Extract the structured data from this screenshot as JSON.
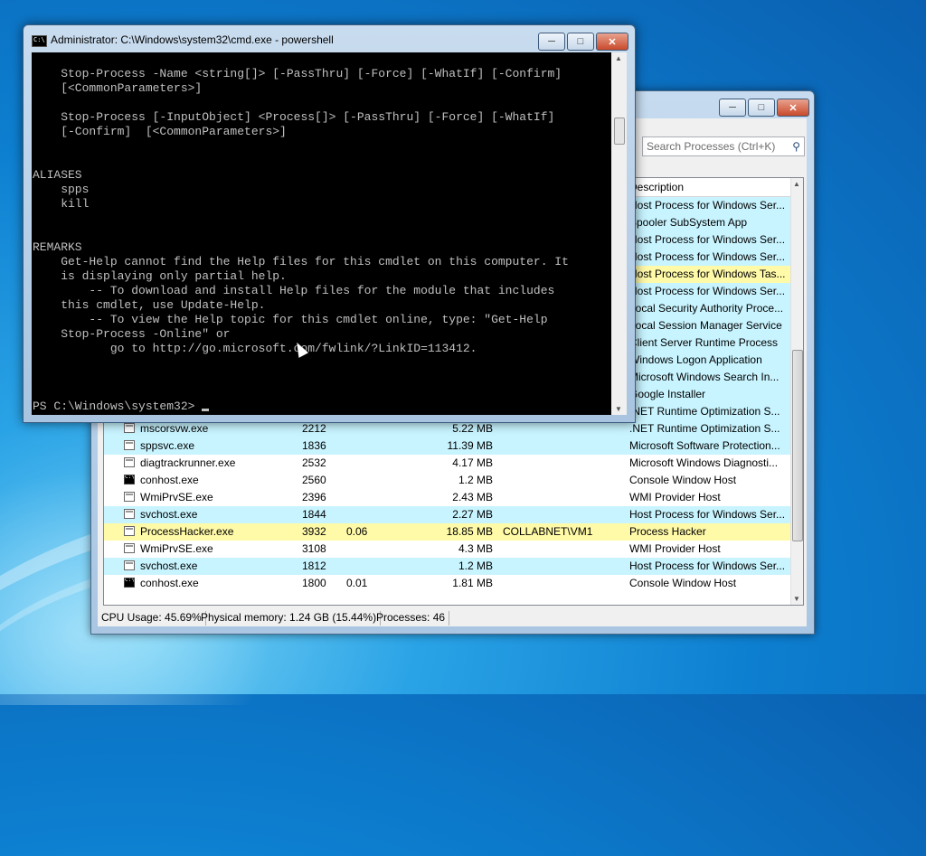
{
  "process_hacker": {
    "search_placeholder": "Search Processes (Ctrl+K)",
    "columns": {
      "description": "Description"
    },
    "rows": [
      {
        "name": "",
        "pid": "",
        "cpu": "",
        "io": "",
        "mem": "",
        "user": "",
        "desc": "Host Process for Windows Ser...",
        "color": "#c8f4ff"
      },
      {
        "name": "",
        "pid": "",
        "cpu": "",
        "io": "",
        "mem": "",
        "user": "",
        "desc": "Spooler SubSystem App",
        "color": "#c8f4ff"
      },
      {
        "name": "",
        "pid": "",
        "cpu": "",
        "io": "",
        "mem": "",
        "user": "",
        "desc": "Host Process for Windows Ser...",
        "color": "#c8f4ff"
      },
      {
        "name": "",
        "pid": "",
        "cpu": "",
        "io": "",
        "mem": "",
        "user": "",
        "desc": "Host Process for Windows Ser...",
        "color": "#c8f4ff"
      },
      {
        "name": "",
        "pid": "",
        "cpu": "",
        "io": "",
        "mem": "",
        "user": "",
        "desc": "Host Process for Windows Tas...",
        "color": "#fffaa8"
      },
      {
        "name": "",
        "pid": "",
        "cpu": "",
        "io": "",
        "mem": "",
        "user": "",
        "desc": "Host Process for Windows Ser...",
        "color": "#c8f4ff"
      },
      {
        "name": "",
        "pid": "",
        "cpu": "",
        "io": "",
        "mem": "",
        "user": "",
        "desc": "Local Security Authority Proce...",
        "color": "#c8f4ff"
      },
      {
        "name": "",
        "pid": "",
        "cpu": "",
        "io": "",
        "mem": "",
        "user": "",
        "desc": "Local Session Manager Service",
        "color": "#c8f4ff"
      },
      {
        "name": "",
        "pid": "",
        "cpu": "",
        "io": "",
        "mem": "",
        "user": "",
        "desc": "Client Server Runtime Process",
        "color": "#c8f4ff"
      },
      {
        "name": "",
        "pid": "",
        "cpu": "",
        "io": "",
        "mem": "",
        "user": "",
        "desc": "Windows Logon Application",
        "color": "#c8f4ff"
      },
      {
        "name": "",
        "pid": "",
        "cpu": "",
        "io": "",
        "mem": "",
        "user": "",
        "desc": "Microsoft Windows Search In...",
        "color": "#c8f4ff"
      },
      {
        "name": "",
        "pid": "",
        "cpu": "",
        "io": "",
        "mem": "",
        "user": "",
        "desc": "Google Installer",
        "color": "#c8f4ff"
      },
      {
        "name": "",
        "pid": "",
        "cpu": "",
        "io": "",
        "mem": "",
        "user": "",
        "desc": ".NET Runtime Optimization S...",
        "color": "#c8f4ff"
      },
      {
        "name": "mscorsvw.exe",
        "pid": "2212",
        "cpu": "",
        "io": "",
        "mem": "5.22 MB",
        "user": "",
        "desc": ".NET Runtime Optimization S...",
        "color": "#c8f4ff",
        "icon": "app"
      },
      {
        "name": "sppsvc.exe",
        "pid": "1836",
        "cpu": "",
        "io": "",
        "mem": "11.39 MB",
        "user": "",
        "desc": "Microsoft Software Protection...",
        "color": "#c8f4ff",
        "icon": "app"
      },
      {
        "name": "diagtrackrunner.exe",
        "pid": "2532",
        "cpu": "",
        "io": "",
        "mem": "4.17 MB",
        "user": "",
        "desc": "Microsoft Windows Diagnosti...",
        "color": "#ffffff",
        "icon": "app"
      },
      {
        "name": "conhost.exe",
        "pid": "2560",
        "cpu": "",
        "io": "",
        "mem": "1.2 MB",
        "user": "",
        "desc": "Console Window Host",
        "color": "#ffffff",
        "icon": "cmd"
      },
      {
        "name": "WmiPrvSE.exe",
        "pid": "2396",
        "cpu": "",
        "io": "",
        "mem": "2.43 MB",
        "user": "",
        "desc": "WMI Provider Host",
        "color": "#ffffff",
        "icon": "app"
      },
      {
        "name": "svchost.exe",
        "pid": "1844",
        "cpu": "",
        "io": "",
        "mem": "2.27 MB",
        "user": "",
        "desc": "Host Process for Windows Ser...",
        "color": "#c8f4ff",
        "icon": "app"
      },
      {
        "name": "ProcessHacker.exe",
        "pid": "3932",
        "cpu": "0.06",
        "io": "",
        "mem": "18.85 MB",
        "user": "COLLABNET\\VM1",
        "desc": "Process Hacker",
        "color": "#fffaa8",
        "icon": "ph"
      },
      {
        "name": "WmiPrvSE.exe",
        "pid": "3108",
        "cpu": "",
        "io": "",
        "mem": "4.3 MB",
        "user": "",
        "desc": "WMI Provider Host",
        "color": "#ffffff",
        "icon": "app"
      },
      {
        "name": "svchost.exe",
        "pid": "1812",
        "cpu": "",
        "io": "",
        "mem": "1.2 MB",
        "user": "",
        "desc": "Host Process for Windows Ser...",
        "color": "#c8f4ff",
        "icon": "app"
      },
      {
        "name": "conhost.exe",
        "pid": "1800",
        "cpu": "0.01",
        "io": "",
        "mem": "1.81 MB",
        "user": "",
        "desc": "Console Window Host",
        "color": "#ffffff",
        "icon": "cmd"
      }
    ],
    "status": {
      "cpu": "CPU Usage: 45.69%",
      "memory": "Physical memory: 1.24 GB (15.44%)",
      "processes": "Processes: 46"
    }
  },
  "cmd": {
    "title": "Administrator: C:\\Windows\\system32\\cmd.exe - powershell",
    "lines": [
      "",
      "    Stop-Process -Name <string[]> [-PassThru] [-Force] [-WhatIf] [-Confirm]",
      "    [<CommonParameters>]",
      "",
      "    Stop-Process [-InputObject] <Process[]> [-PassThru] [-Force] [-WhatIf]",
      "    [-Confirm]  [<CommonParameters>]",
      "",
      "",
      "ALIASES",
      "    spps",
      "    kill",
      "",
      "",
      "REMARKS",
      "    Get-Help cannot find the Help files for this cmdlet on this computer. It",
      "    is displaying only partial help.",
      "        -- To download and install Help files for the module that includes",
      "    this cmdlet, use Update-Help.",
      "        -- To view the Help topic for this cmdlet online, type: \"Get-Help",
      "    Stop-Process -Online\" or",
      "           go to http://go.microsoft.com/fwlink/?LinkID=113412.",
      "",
      "",
      ""
    ],
    "prompt": "PS C:\\Windows\\system32> "
  },
  "colors": {
    "console_bg": "#000000",
    "console_fg": "#c0c0c0",
    "service_row": "#c8f4ff",
    "own_process_row": "#fffaa8"
  }
}
